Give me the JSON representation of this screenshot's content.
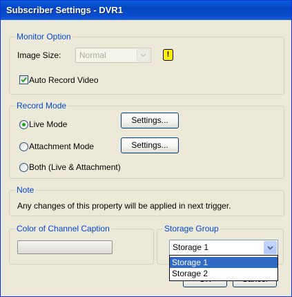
{
  "window": {
    "title": "Subscriber Settings - DVR1"
  },
  "monitor_option": {
    "legend": "Monitor Option",
    "image_size_label": "Image Size:",
    "image_size_value": "Normal",
    "warning_glyph": "!",
    "auto_record_label": "Auto Record Video",
    "auto_record_checked": true
  },
  "record_mode": {
    "legend": "Record Mode",
    "options": [
      {
        "label": "Live Mode",
        "selected": true,
        "settings_label": "Settings..."
      },
      {
        "label": "Attachment Mode",
        "selected": false,
        "settings_label": "Settings..."
      },
      {
        "label": "Both (Live & Attachment)",
        "selected": false
      }
    ]
  },
  "note": {
    "legend": "Note",
    "text": "Any changes of this property will be applied in next trigger."
  },
  "color_caption": {
    "legend": "Color of Channel Caption"
  },
  "storage_group": {
    "legend": "Storage Group",
    "selected": "Storage 1",
    "options": [
      "Storage 1",
      "Storage 2"
    ]
  },
  "buttons": {
    "ok": "OK",
    "cancel": "Cancel"
  },
  "colors": {
    "title_bar": "#0a4fd0",
    "legend_text": "#0046d5",
    "selection": "#316ac5",
    "radio_dot": "#21a121",
    "warning_yellow": "#ffee00"
  },
  "icons": [
    "warning-icon",
    "checkbox-checked-icon",
    "radio-icon",
    "chevron-down-icon"
  ]
}
